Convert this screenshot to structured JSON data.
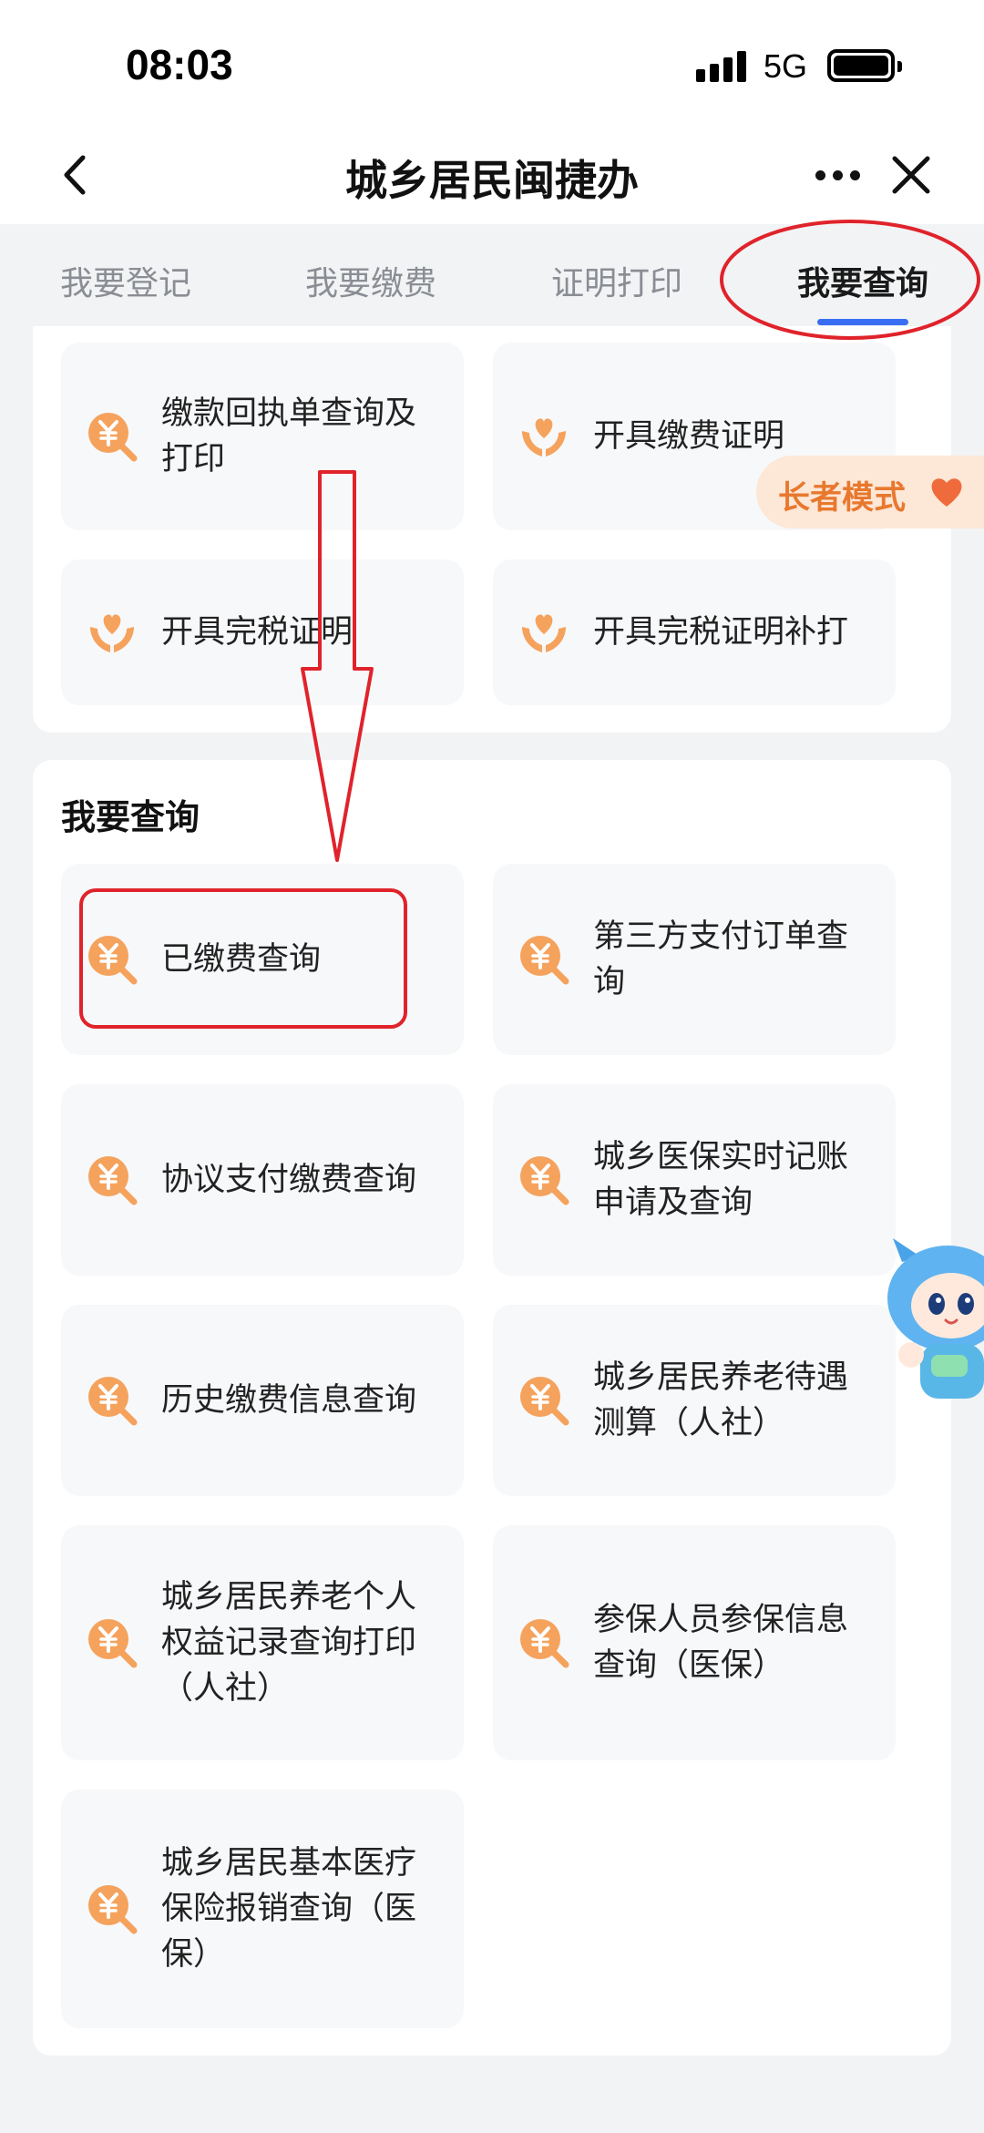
{
  "status_bar": {
    "time": "08:03",
    "network": "5G"
  },
  "nav": {
    "title": "城乡居民闽捷办"
  },
  "tabs": [
    {
      "label": "我要登记"
    },
    {
      "label": "我要缴费"
    },
    {
      "label": "证明打印"
    },
    {
      "label": "我要查询"
    }
  ],
  "active_tab": "我要查询",
  "elder_mode": {
    "label": "长者模式"
  },
  "print_section": {
    "items": [
      {
        "label": "缴款回执单查询及打印",
        "icon": "yuan-search-icon"
      },
      {
        "label": "开具缴费证明",
        "icon": "heart-hands-icon"
      },
      {
        "label": "开具完税证明",
        "icon": "heart-hands-icon"
      },
      {
        "label": "开具完税证明补打",
        "icon": "heart-hands-icon"
      }
    ]
  },
  "query_section": {
    "title": "我要查询",
    "items": [
      {
        "label": "已缴费查询",
        "icon": "yuan-search-icon"
      },
      {
        "label": "第三方支付订单查询",
        "icon": "yuan-search-icon"
      },
      {
        "label": "协议支付缴费查询",
        "icon": "yuan-search-icon"
      },
      {
        "label": "城乡医保实时记账申请及查询",
        "icon": "yuan-search-icon"
      },
      {
        "label": "历史缴费信息查询",
        "icon": "yuan-search-icon"
      },
      {
        "label": "城乡居民养老待遇测算（人社）",
        "icon": "yuan-search-icon"
      },
      {
        "label": "城乡居民养老个人权益记录查询打印（人社）",
        "icon": "yuan-search-icon"
      },
      {
        "label": "参保人员参保信息查询（医保）",
        "icon": "yuan-search-icon"
      },
      {
        "label": "城乡居民基本医疗保险报销查询（医保）",
        "icon": "yuan-search-icon"
      }
    ]
  },
  "colors": {
    "accent": "#3a6ef2",
    "icon_orange": "#f5a25d",
    "annotation_red": "#e0232b",
    "tile_bg": "#f7f8fa"
  }
}
